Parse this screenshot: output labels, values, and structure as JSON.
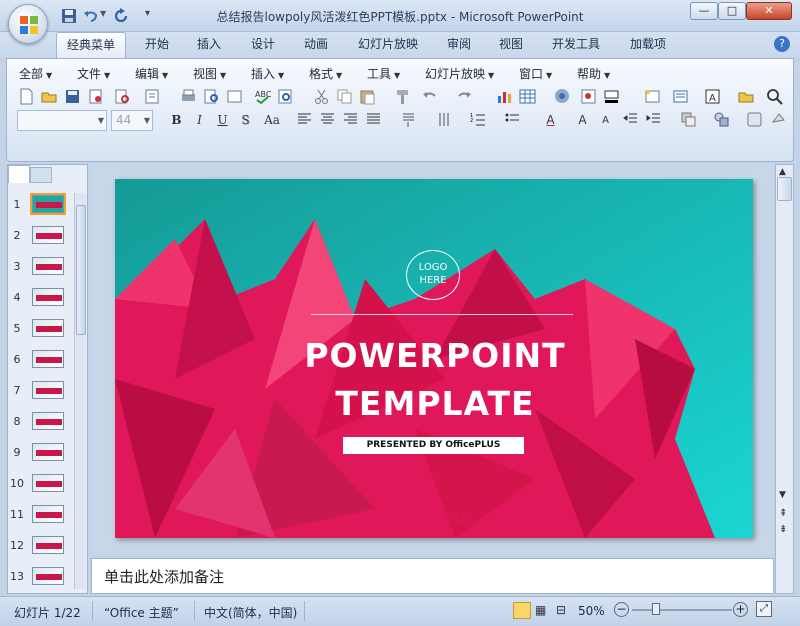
{
  "window": {
    "title": "总结报告lowpoly风活泼红色PPT模板.pptx - Microsoft PowerPoint",
    "min_label": "—",
    "max_label": "□",
    "close_label": "✕"
  },
  "ribbon_tabs": [
    "经典菜单",
    "开始",
    "插入",
    "设计",
    "动画",
    "幻灯片放映",
    "审阅",
    "视图",
    "开发工具",
    "加载项"
  ],
  "help_label": "?",
  "menus": [
    "全部",
    "文件",
    "编辑",
    "视图",
    "插入",
    "格式",
    "工具",
    "幻灯片放映",
    "窗口",
    "帮助"
  ],
  "format": {
    "font_name": "",
    "font_size": "44",
    "bold": "B",
    "italic": "I",
    "underline": "U",
    "shadow": "S",
    "case": "Aa",
    "text_color": "A",
    "grow": "A",
    "shrink": "A"
  },
  "slides": [
    {
      "no": "1"
    },
    {
      "no": "2"
    },
    {
      "no": "3"
    },
    {
      "no": "4"
    },
    {
      "no": "5"
    },
    {
      "no": "6"
    },
    {
      "no": "7"
    },
    {
      "no": "8"
    },
    {
      "no": "9"
    },
    {
      "no": "10"
    },
    {
      "no": "11"
    },
    {
      "no": "12"
    },
    {
      "no": "13"
    }
  ],
  "selected_slide": 1,
  "slide": {
    "logo_line1": "LOGO",
    "logo_line2": "HERE",
    "title_line1": "POWERPOINT",
    "title_line2": "TEMPLATE",
    "presented": "PRESENTED BY OfficePLUS",
    "watermark": "OfficePLUS"
  },
  "notes_placeholder": "单击此处添加备注",
  "status": {
    "slide_info": "幻灯片 1/22",
    "theme": "“Office 主题”",
    "language": "中文(简体，中国)",
    "zoom": "50%",
    "zoom_level": 0.5
  },
  "colors": {
    "accent_red": "#e8174f",
    "teal": "#1fa8a0",
    "ribbon": "#c8d7ec"
  }
}
